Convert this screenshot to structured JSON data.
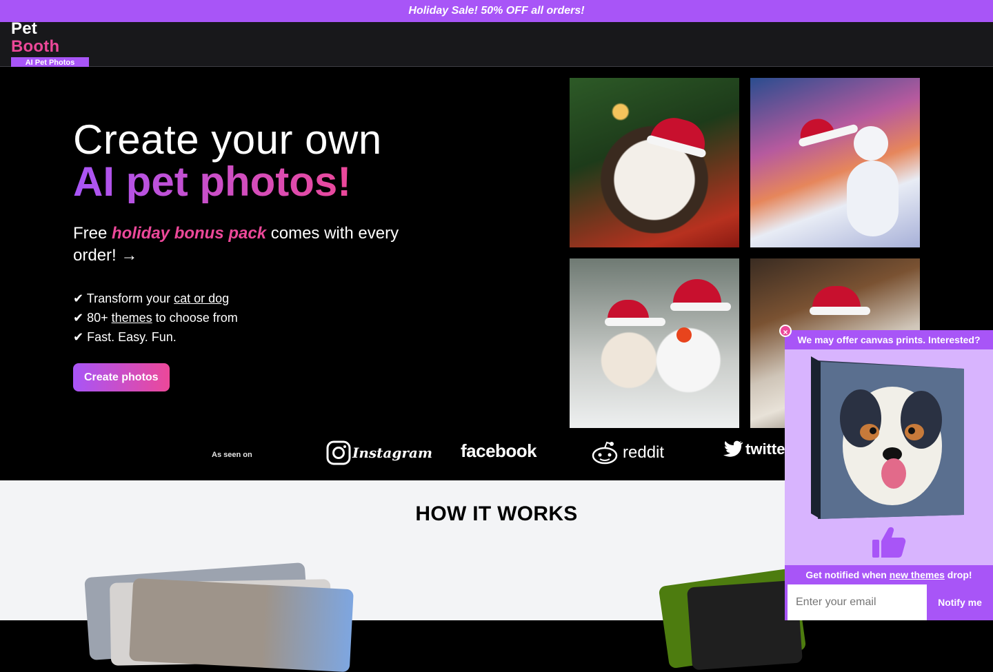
{
  "banner": {
    "text": "Holiday Sale! 50% OFF all orders!"
  },
  "nav": {
    "logo_part1": "Pet",
    "logo_part2": "Booth",
    "logo_sub": "AI Pet Photos"
  },
  "hero": {
    "title_line1": "Create your own",
    "title_line2": "AI pet photos!",
    "subtitle_before": "Free ",
    "subtitle_emphasis": "holiday bonus pack",
    "subtitle_after": " comes with every order! →",
    "features": [
      {
        "prefix": "✔ Transform your ",
        "link": "cat or dog",
        "suffix": ""
      },
      {
        "prefix": "✔ 80+ ",
        "link": "themes",
        "suffix": " to choose from"
      },
      {
        "prefix": "✔ Fast. Easy. Fun.",
        "link": "",
        "suffix": ""
      }
    ],
    "cta_label": "Create photos"
  },
  "as_seen_on": {
    "label": "As seen on",
    "brands": [
      "Instagram",
      "facebook",
      "reddit",
      "twitter"
    ]
  },
  "how_it_works": {
    "title": "HOW IT WORKS"
  },
  "popup": {
    "close_label": "×",
    "heading": "We may offer canvas prints. Interested?",
    "notify_before": "Get notified when ",
    "notify_link": "new themes",
    "notify_after": " drop!",
    "email_placeholder": "Enter your email",
    "notify_button": "Notify me",
    "thumb_icon": "thumbs-up-icon"
  },
  "colors": {
    "purple": "#a855f7",
    "pink": "#ec4899",
    "popup_bg": "#d8b4fe"
  }
}
